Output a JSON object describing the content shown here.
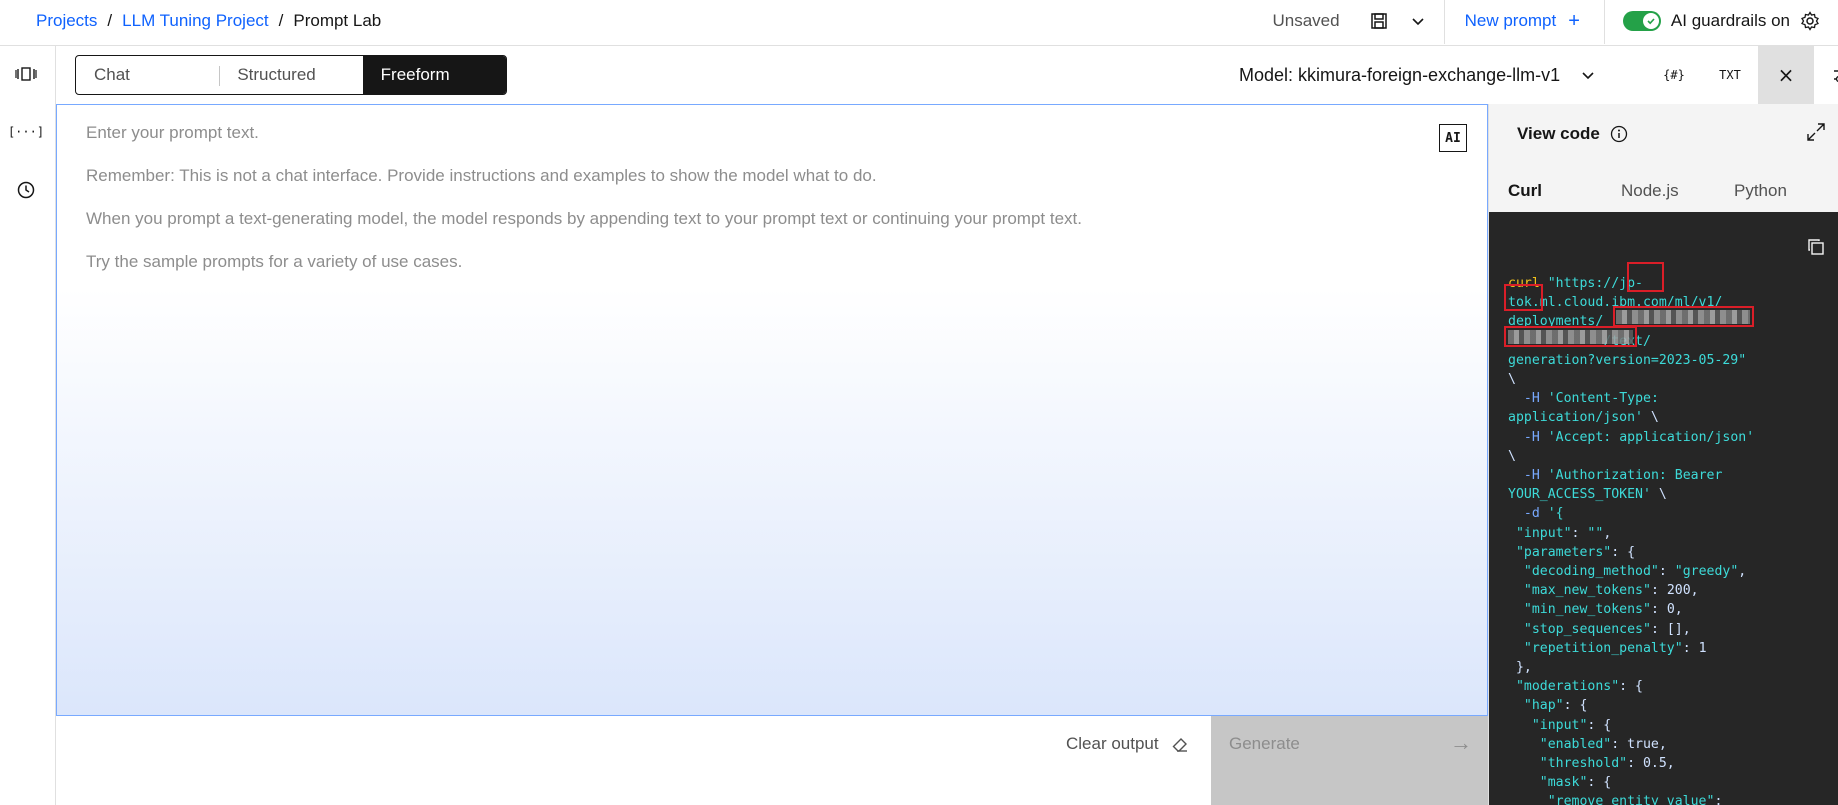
{
  "breadcrumb": {
    "projects": "Projects",
    "project": "LLM Tuning Project",
    "current": "Prompt Lab",
    "separator": "/"
  },
  "topbar": {
    "status": "Unsaved",
    "new_prompt": "New prompt",
    "guardrails": "AI guardrails on",
    "guardrails_enabled": true
  },
  "modes": {
    "chat": "Chat",
    "structured": "Structured",
    "freeform": "Freeform",
    "active": "Freeform"
  },
  "model": {
    "label": "Model: kkimura-foreign-exchange-llm-v1"
  },
  "tools": {
    "json": "{#}",
    "txt": "TXT",
    "close": "×"
  },
  "editor": {
    "ai_badge": "AI",
    "placeholder_lines": [
      "Enter your prompt text.",
      "Remember: This is not a chat interface. Provide instructions and examples to show the model what to do.",
      "When you prompt a text-generating model, the model responds by appending text to your prompt text or continuing your prompt text.",
      "Try the sample prompts for a variety of use cases."
    ]
  },
  "actions": {
    "clear_output": "Clear output",
    "generate": "Generate"
  },
  "code_panel": {
    "title": "View code",
    "tabs": [
      "Curl",
      "Node.js",
      "Python"
    ],
    "active_tab": "Curl"
  },
  "colors": {
    "accent": "#0f62fe",
    "toggle_on": "#24a148",
    "highlight": "#da1e28"
  }
}
